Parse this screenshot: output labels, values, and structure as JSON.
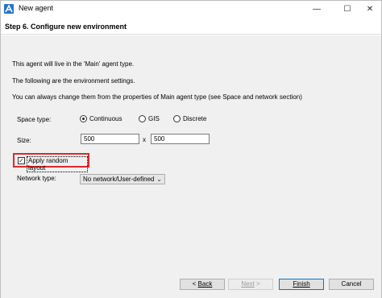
{
  "window": {
    "title": "New agent",
    "minimize": "—",
    "maximize": "☐",
    "close": "✕"
  },
  "header": {
    "step_title": "Step 6. Configure new environment"
  },
  "info": {
    "line1": "This agent will live in the 'Main' agent type.",
    "line2": "The following are the environment settings.",
    "line3": "You can always change them from the properties of Main agent type (see Space and network section)"
  },
  "form": {
    "space_type_label": "Space type:",
    "space_options": [
      "Continuous",
      "GIS",
      "Discrete"
    ],
    "space_selected": "Continuous",
    "size_label": "Size:",
    "width": "500",
    "times": "x",
    "height": "500",
    "random_layout_label": "Apply random layout",
    "random_layout_checked": true,
    "network_label": "Network type:",
    "network_value": "No network/User-defined"
  },
  "footer": {
    "back_arrow": "<",
    "back_label": "Back",
    "next_label": "Next",
    "next_arrow": ">",
    "finish_label": "Finish",
    "cancel_label": "Cancel"
  },
  "colors": {
    "highlight_border": "#e0282a",
    "default_button_border": "#0078d7",
    "app_icon": "#2a73c7"
  }
}
